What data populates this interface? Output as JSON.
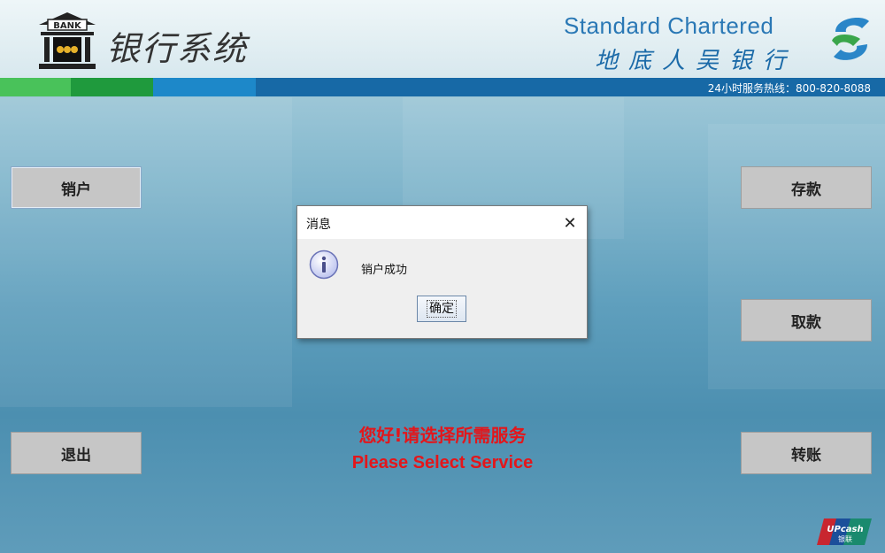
{
  "header": {
    "system_title": "银行系统",
    "bank_logo_label": "BANK",
    "brand_name_en": "Standard Chartered",
    "brand_name_cn": "地底人吴银行",
    "hotline": "24小时服务热线：800-820-8088"
  },
  "side_buttons": {
    "close_account": "销户",
    "exit": "退出",
    "deposit": "存款",
    "withdraw": "取款",
    "transfer": "转账"
  },
  "welcome": {
    "chinese": "您好!请选择所需服务",
    "english": "Please Select Service"
  },
  "dialog": {
    "title": "消息",
    "message": "销户成功",
    "ok_label": "确定"
  },
  "footer": {
    "upcash_label": "UPcash 银联"
  },
  "colors": {
    "accent_red": "#e3161b",
    "brand_blue": "#1769a6",
    "brand_green": "#1f9a3d"
  },
  "icons": [
    "bank-building-icon",
    "standard-chartered-logo-icon",
    "info-icon",
    "close-icon",
    "upcash-logo-icon"
  ]
}
